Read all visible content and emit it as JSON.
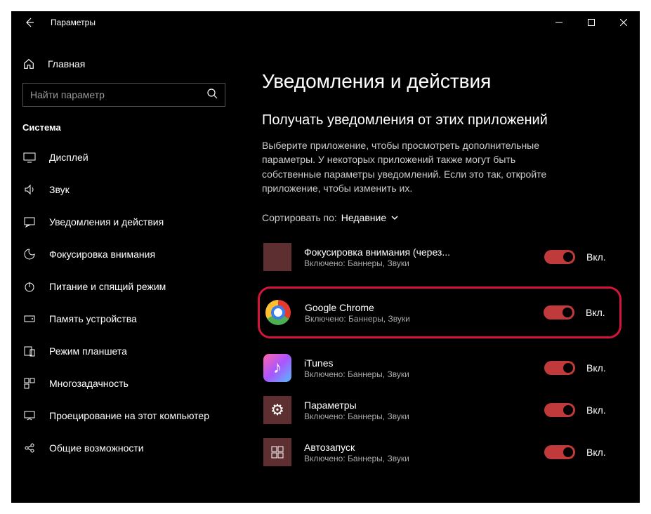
{
  "titlebar": {
    "title": "Параметры"
  },
  "sidebar": {
    "home": "Главная",
    "search_placeholder": "Найти параметр",
    "section": "Система",
    "items": [
      {
        "label": "Дисплей",
        "icon": "display"
      },
      {
        "label": "Звук",
        "icon": "sound"
      },
      {
        "label": "Уведомления и действия",
        "icon": "notifications"
      },
      {
        "label": "Фокусировка внимания",
        "icon": "focus-assist"
      },
      {
        "label": "Питание и спящий режим",
        "icon": "power"
      },
      {
        "label": "Память устройства",
        "icon": "storage"
      },
      {
        "label": "Режим планшета",
        "icon": "tablet"
      },
      {
        "label": "Многозадачность",
        "icon": "multitasking"
      },
      {
        "label": "Проецирование на этот компьютер",
        "icon": "projecting"
      },
      {
        "label": "Общие возможности",
        "icon": "shared"
      }
    ]
  },
  "main": {
    "heading": "Уведомления и действия",
    "subheading": "Получать уведомления от этих приложений",
    "description": "Выберите приложение, чтобы просмотреть дополнительные параметры. У некоторых приложений также могут быть собственные параметры уведомлений. Если это так, откройте приложение, чтобы изменить их.",
    "sort_label": "Сортировать по:",
    "sort_value": "Недавние",
    "toggle_on": "Вкл.",
    "apps": [
      {
        "name": "Фокусировка внимания (через...",
        "sub": "Включено: Баннеры, Звуки",
        "highlighted": false,
        "icon": "focus"
      },
      {
        "name": "Google Chrome",
        "sub": "Включено: Баннеры, Звуки",
        "highlighted": true,
        "icon": "chrome"
      },
      {
        "name": "iTunes",
        "sub": "Включено: Баннеры, Звуки",
        "highlighted": false,
        "icon": "itunes"
      },
      {
        "name": "Параметры",
        "sub": "Включено: Баннеры, Звуки",
        "highlighted": false,
        "icon": "settings"
      },
      {
        "name": "Автозапуск",
        "sub": "Включено: Баннеры, Звуки",
        "highlighted": false,
        "icon": "autostart"
      }
    ]
  }
}
